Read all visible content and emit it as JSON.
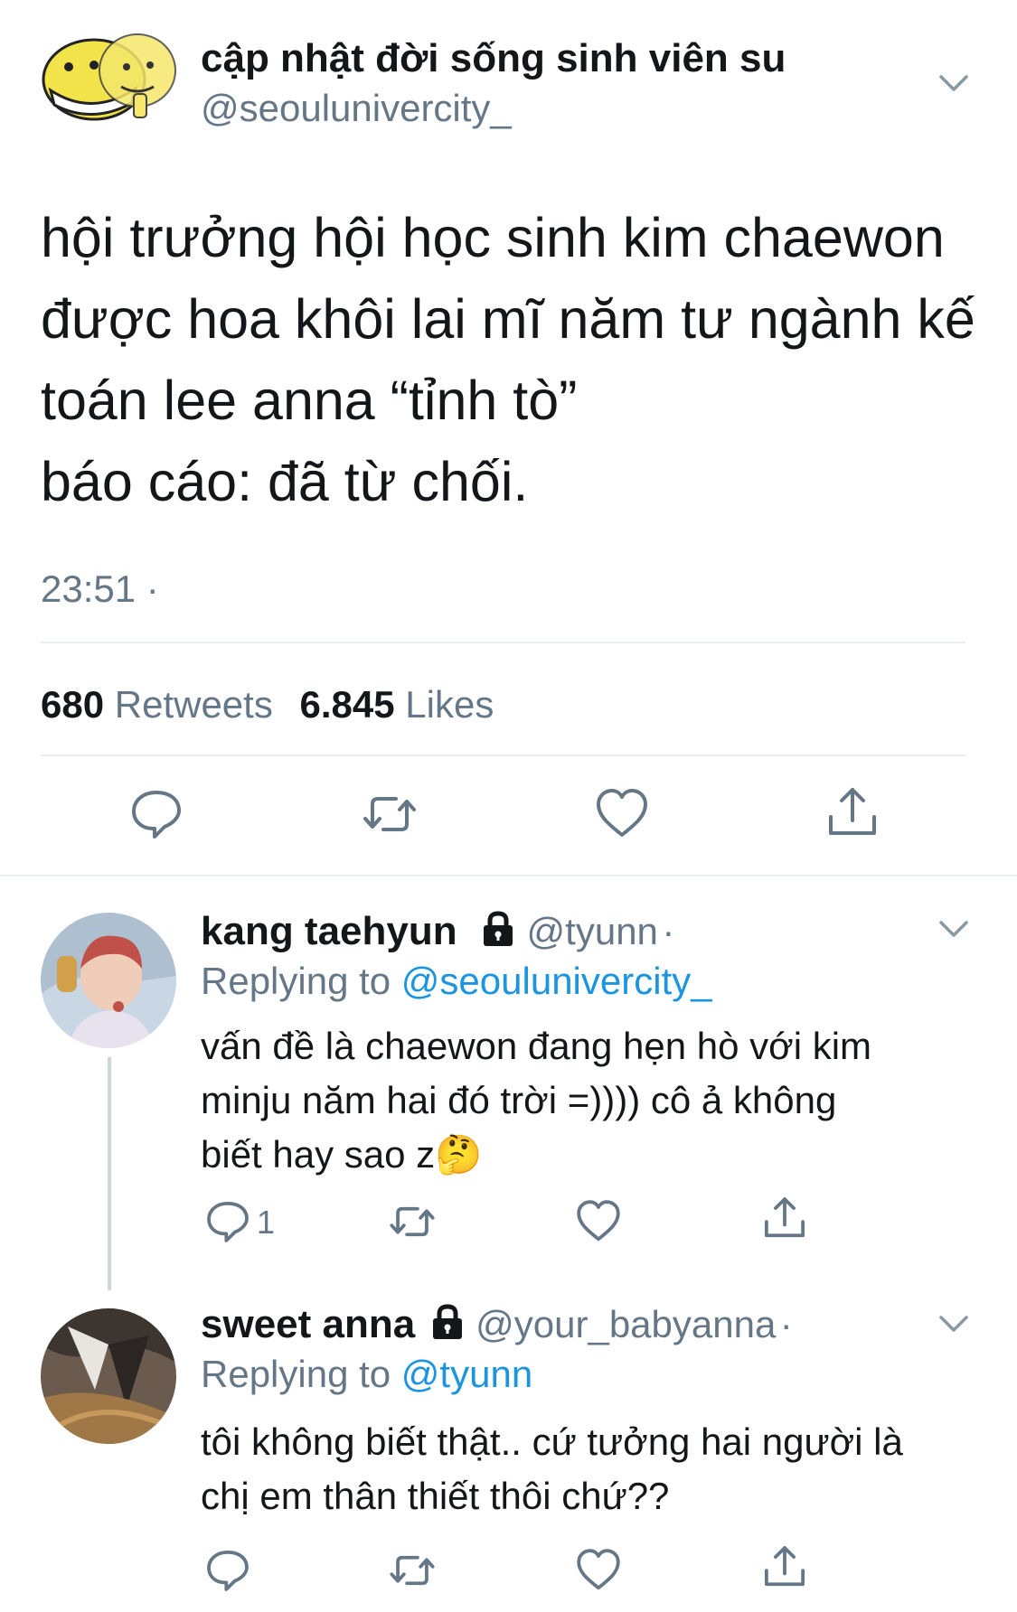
{
  "main_tweet": {
    "display_name": "cập nhật đời sống sinh viên su",
    "handle": "@seoulunivercity_",
    "text_lines": [
      "hội trưởng hội học sinh kim chaewon",
      "được hoa khôi lai mĩ năm tư ngành kế",
      "toán lee anna “tỉnh tò”",
      "báo cáo: đã từ chối."
    ],
    "time": "23:51 ·",
    "retweets_count": "680",
    "retweets_label": "Retweets",
    "likes_count": "6.845",
    "likes_label": "Likes",
    "avatar_icon": "cartoon-face-icon"
  },
  "replies": [
    {
      "display_name": "kang taehyun",
      "handle": "@tyunn",
      "dot": "·",
      "replying_label": "Replying to",
      "replying_to": "@seoulunivercity_",
      "text_lines": [
        "vấn đề là chaewon đang hẹn hò với kim",
        "minju năm hai đó trời =)))) cô ả không",
        "biết hay sao z🤔"
      ],
      "reply_count": "1",
      "locked": true
    },
    {
      "display_name": "sweet anna",
      "handle": "@your_babyanna",
      "dot": "·",
      "replying_label": "Replying to",
      "replying_to": "@tyunn",
      "text_lines": [
        "tôi không biết thật.. cứ tưởng hai người là",
        "chị em thân thiết thôi chứ??"
      ],
      "reply_count": "",
      "locked": true
    }
  ],
  "colors": {
    "text": "#14171a",
    "muted": "#657786",
    "link": "#1b95e0",
    "divider": "#e6ecf0"
  }
}
